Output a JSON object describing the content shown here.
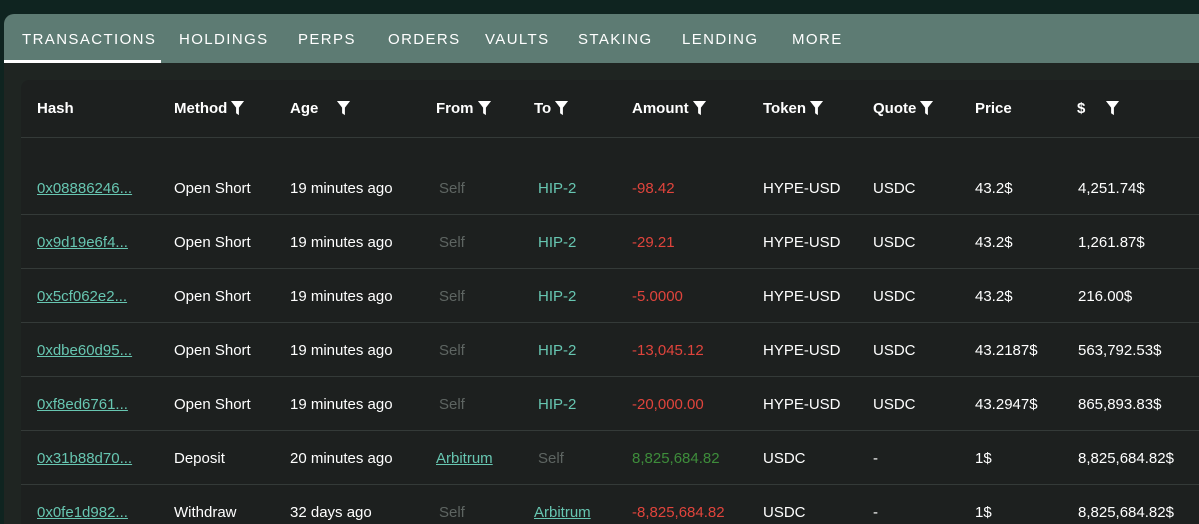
{
  "tabs": [
    {
      "label": "TRANSACTIONS",
      "active": true
    },
    {
      "label": "HOLDINGS"
    },
    {
      "label": "PERPS"
    },
    {
      "label": "ORDERS"
    },
    {
      "label": "VAULTS"
    },
    {
      "label": "STAKING"
    },
    {
      "label": "LENDING"
    },
    {
      "label": "MORE"
    }
  ],
  "columns": [
    "Hash",
    "Method",
    "Age",
    "From",
    "To",
    "Amount",
    "Token",
    "Quote",
    "Price",
    "$"
  ],
  "rows": [
    {
      "hash": "0x08886246...",
      "method": "Open Short",
      "age": "19 minutes ago",
      "from": "Self",
      "to": "HIP-2",
      "amount": "-98.42",
      "token": "HYPE-USD",
      "quote": "USDC",
      "price": "43.2$",
      "usd": "4,251.74$"
    },
    {
      "hash": "0x9d19e6f4...",
      "method": "Open Short",
      "age": "19 minutes ago",
      "from": "Self",
      "to": "HIP-2",
      "amount": "-29.21",
      "token": "HYPE-USD",
      "quote": "USDC",
      "price": "43.2$",
      "usd": "1,261.87$"
    },
    {
      "hash": "0x5cf062e2...",
      "method": "Open Short",
      "age": "19 minutes ago",
      "from": "Self",
      "to": "HIP-2",
      "amount": "-5.0000",
      "token": "HYPE-USD",
      "quote": "USDC",
      "price": "43.2$",
      "usd": "216.00$"
    },
    {
      "hash": "0xdbe60d95...",
      "method": "Open Short",
      "age": "19 minutes ago",
      "from": "Self",
      "to": "HIP-2",
      "amount": "-13,045.12",
      "token": "HYPE-USD",
      "quote": "USDC",
      "price": "43.2187$",
      "usd": "563,792.53$"
    },
    {
      "hash": "0xf8ed6761...",
      "method": "Open Short",
      "age": "19 minutes ago",
      "from": "Self",
      "to": "HIP-2",
      "amount": "-20,000.00",
      "token": "HYPE-USD",
      "quote": "USDC",
      "price": "43.2947$",
      "usd": "865,893.83$"
    },
    {
      "hash": "0x31b88d70...",
      "method": "Deposit",
      "age": "20 minutes ago",
      "from": "Arbitrum",
      "to": "Self",
      "amount": "8,825,684.82",
      "token": "USDC",
      "quote": "-",
      "price": "1$",
      "usd": "8,825,684.82$"
    },
    {
      "hash": "0x0fe1d982...",
      "method": "Withdraw",
      "age": "32 days ago",
      "from": "Self",
      "to": "Arbitrum",
      "amount": "-8,825,684.82",
      "token": "USDC",
      "quote": "-",
      "price": "1$",
      "usd": "8,825,684.82$"
    }
  ],
  "colors": {
    "accent": "#67c6b1",
    "negative": "#e0443c",
    "positive": "#3e8d3b",
    "tabbar": "#5d7b73"
  },
  "icons": {
    "filter": "filter-funnel-icon"
  }
}
